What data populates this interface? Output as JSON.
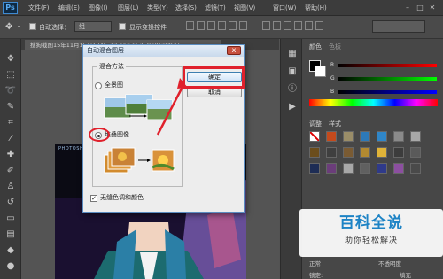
{
  "app": {
    "logo": "Ps"
  },
  "menu": [
    "文件(F)",
    "编辑(E)",
    "图像(I)",
    "图层(L)",
    "类型(Y)",
    "选择(S)",
    "滤镜(T)",
    "视图(V)",
    "窗口(W)",
    "帮助(H)"
  ],
  "options_bar": {
    "auto_select_label": "自动选择：",
    "auto_select_value": "组",
    "show_transform_label": "显示变换控件"
  },
  "document_tab": {
    "title": "搜狗截图15年11月15日1745_12.png @ 25%(RGB/8#)"
  },
  "canvas": {
    "corner_text": "PHOTOSHOP"
  },
  "right_panel": {
    "tabs_top": [
      "颜色",
      "色板"
    ],
    "sliders": [
      "R",
      "G",
      "B"
    ],
    "tabs_mid": [
      "调整",
      "样式"
    ],
    "bottom_left": "正常",
    "bottom_right": "不透明度",
    "lock_label": "锁定:",
    "fill_label": "填充"
  },
  "dialog": {
    "title": "自动混合图层",
    "close": "x",
    "group_label": "混合方法",
    "option_panorama": "全景图",
    "option_stack": "堆叠图像",
    "checkbox_label": "无缝色调和颜色",
    "ok": "确定",
    "cancel": "取消"
  },
  "watermark": {
    "title": "百科全说",
    "subtitle": "助你轻松解决"
  },
  "colors": {
    "highlight": "#e0212c",
    "accent": "#1d83c5"
  }
}
